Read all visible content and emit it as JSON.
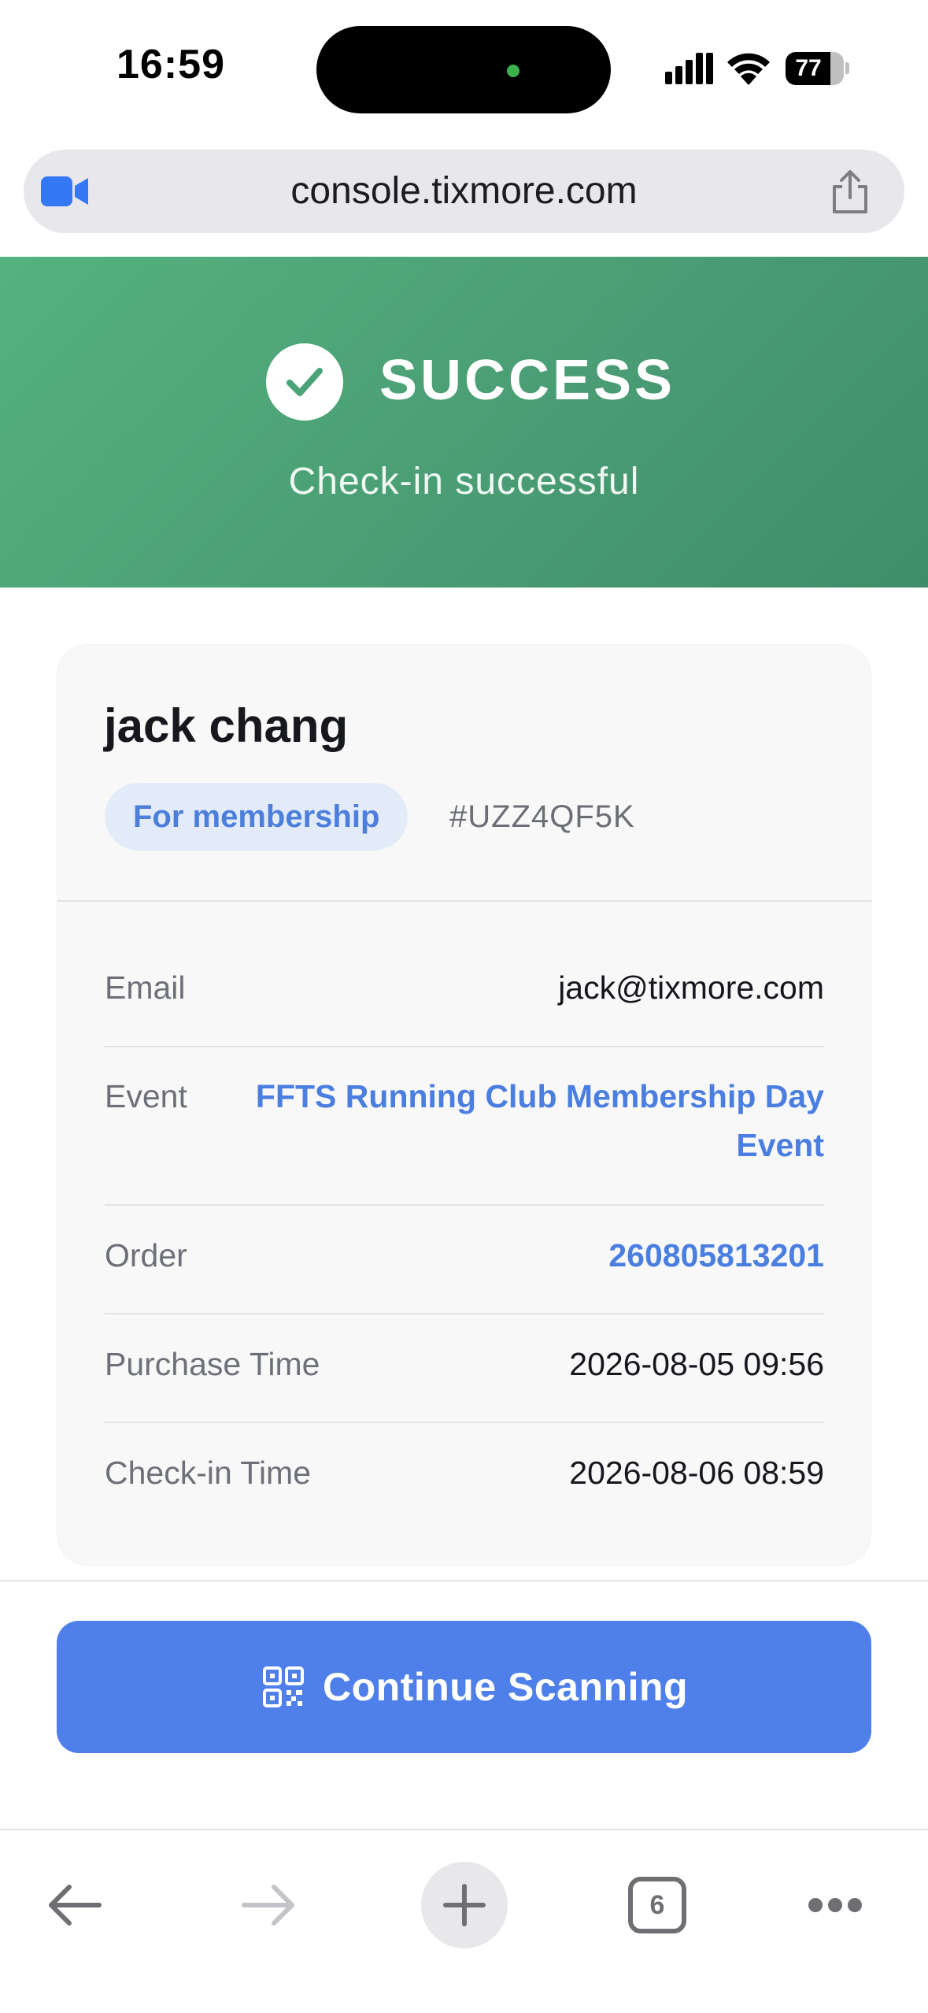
{
  "status_bar": {
    "time": "16:59",
    "battery_level": "77"
  },
  "browser": {
    "url": "console.tixmore.com",
    "open_tabs": "6"
  },
  "banner": {
    "title": "SUCCESS",
    "subtitle": "Check-in successful",
    "color": "#52a97a"
  },
  "attendee": {
    "name": "jack chang",
    "ticket_type": "For membership",
    "ticket_code": "#UZZ4QF5K"
  },
  "details": [
    {
      "label": "Email",
      "value": "jack@tixmore.com"
    },
    {
      "label": "Event",
      "value_line1": "FFTS Running Club Membership Day",
      "value_line2": "Event"
    },
    {
      "label": "Order",
      "value": "260805813201"
    },
    {
      "label": "Purchase Time",
      "value": "2026-08-05 09:56"
    },
    {
      "label": "Check-in Time",
      "value": "2026-08-06 08:59"
    }
  ],
  "actions": {
    "continue_label": "Continue Scanning",
    "accent": "#4f80ea"
  },
  "icons": {
    "camera": "video-camera-icon",
    "share": "share-icon",
    "check": "checkmark-icon",
    "qr": "qr-code-icon",
    "back": "arrow-left-icon",
    "forward": "arrow-right-icon",
    "new_tab": "plus-icon",
    "more": "ellipsis-icon"
  }
}
